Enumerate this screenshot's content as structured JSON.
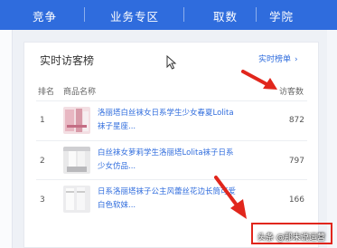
{
  "nav": {
    "items": [
      "竞争",
      "业务专区",
      "取数",
      "学院"
    ]
  },
  "card": {
    "title": "实时访客榜",
    "more_label": "实时榜单",
    "more_icon": "chevron-right-icon"
  },
  "table": {
    "headers": {
      "rank": "排名",
      "product": "商品名称",
      "visitors": "访客数"
    },
    "rows": [
      {
        "rank": "1",
        "name": "洛丽塔白丝袜女日系学生少女春夏Lolita袜子星座...",
        "count": "872"
      },
      {
        "rank": "2",
        "name": "白丝袜女萝莉学生洛丽塔Lolita袜子日系少女仿品...",
        "count": "797"
      },
      {
        "rank": "3",
        "name": "日系洛丽塔袜子公主风蕾丝花边长筒可爱白色软妹...",
        "count": "166"
      }
    ]
  },
  "watermark": "头条 @那末说运营",
  "colors": {
    "nav_bg": "#2f6cdd",
    "link": "#2f6cdd",
    "annotation": "#e1261c"
  }
}
